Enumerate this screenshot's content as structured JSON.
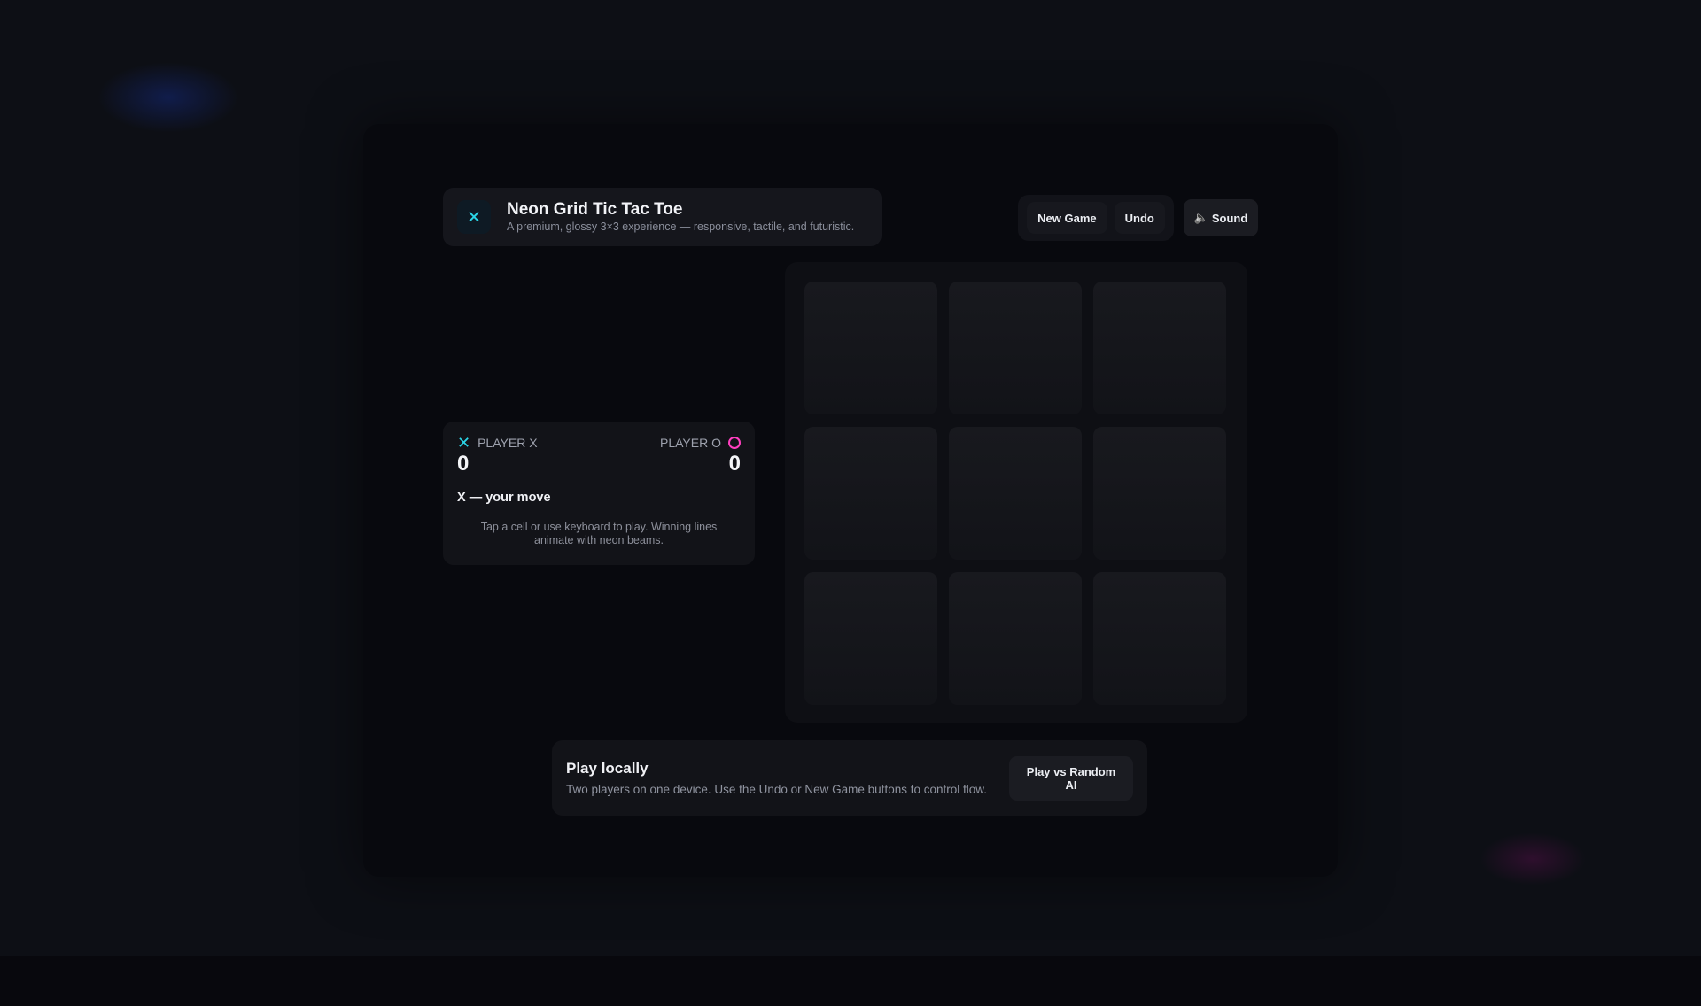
{
  "header": {
    "logo_glyph": "✕",
    "title": "Neon Grid Tic Tac Toe",
    "subtitle": "A premium, glossy 3×3 experience — responsive, tactile, and futuristic."
  },
  "toolbar": {
    "new_game_label": "New Game",
    "undo_label": "Undo",
    "sound_icon": "🔈",
    "sound_label": "Sound"
  },
  "scoreboard": {
    "player_x": {
      "glyph": "✕",
      "label": "PLAYER X",
      "score": "0"
    },
    "player_o": {
      "label": "PLAYER O",
      "score": "0"
    },
    "turn_status": "X — your move",
    "hint": "Tap a cell or use keyboard to play. Winning lines animate with neon beams."
  },
  "board": {
    "cells": [
      "",
      "",
      "",
      "",
      "",
      "",
      "",
      "",
      ""
    ]
  },
  "footer": {
    "title": "Play locally",
    "description": "Two players on one device. Use the Undo or New Game buttons to control flow.",
    "ai_button_label": "Play vs Random AI"
  },
  "colors": {
    "accent_x": "#2bd4e6",
    "accent_o": "#ff3fc0",
    "background": "#0d0f15"
  }
}
